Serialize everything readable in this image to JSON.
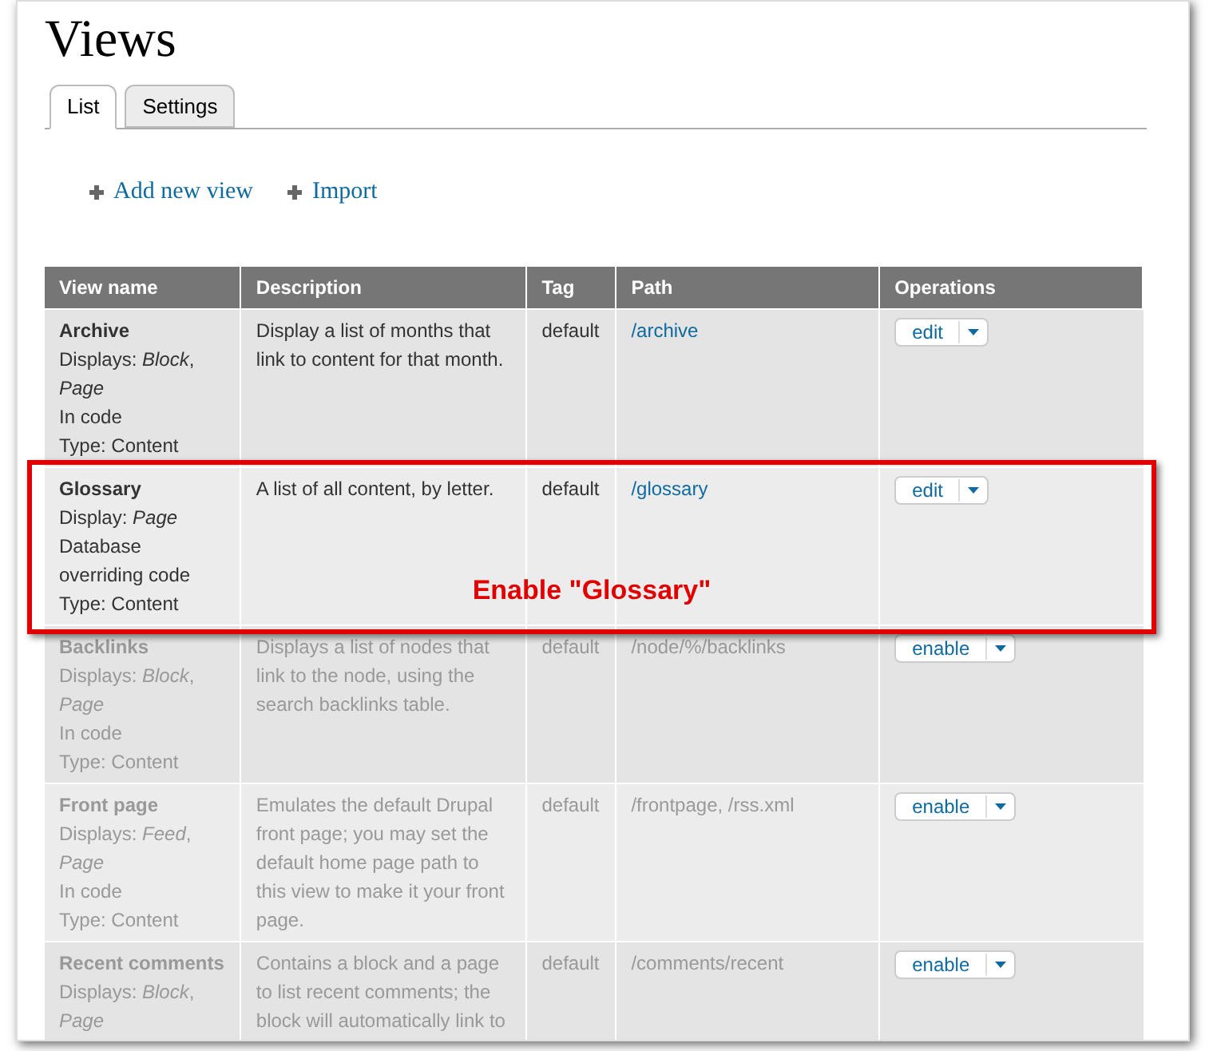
{
  "page": {
    "title": "Views"
  },
  "tabs": [
    {
      "label": "List",
      "selected": true
    },
    {
      "label": "Settings",
      "selected": false
    }
  ],
  "actions": [
    {
      "label": "Add new view"
    },
    {
      "label": "Import"
    }
  ],
  "table": {
    "columns": [
      "View name",
      "Description",
      "Tag",
      "Path",
      "Operations"
    ],
    "rows": [
      {
        "name": "Archive",
        "lines": [
          "Displays: *Block*, *Page*",
          "In code",
          "Type: Content"
        ],
        "description": "Display a list of months that link to content for that month.",
        "tag": "default",
        "path": "/archive",
        "operation": "edit",
        "enabled": true
      },
      {
        "name": "Glossary",
        "lines": [
          "Display: *Page*",
          "Database overriding code",
          "Type: Content"
        ],
        "description": "A list of all content, by letter.",
        "tag": "default",
        "path": "/glossary",
        "operation": "edit",
        "enabled": true
      },
      {
        "name": "Backlinks",
        "lines": [
          "Displays: *Block*, *Page*",
          "In code",
          "Type: Content"
        ],
        "description": "Displays a list of nodes that link to the node, using the search backlinks table.",
        "tag": "default",
        "path": "/node/%/backlinks",
        "operation": "enable",
        "enabled": false
      },
      {
        "name": "Front page",
        "lines": [
          "Displays: *Feed*, *Page*",
          "In code",
          "Type: Content"
        ],
        "description": "Emulates the default Drupal front page; you may set the default home page path to this view to make it your front page.",
        "tag": "default",
        "path": "/frontpage, /rss.xml",
        "operation": "enable",
        "enabled": false
      },
      {
        "name": "Recent comments",
        "lines": [
          "Displays: *Block*, *Page*"
        ],
        "description": "Contains a block and a page to list recent comments; the block will automatically link to",
        "tag": "default",
        "path": "/comments/recent",
        "operation": "enable",
        "enabled": false
      }
    ]
  },
  "annotation": {
    "label": "Enable \"Glossary\""
  }
}
